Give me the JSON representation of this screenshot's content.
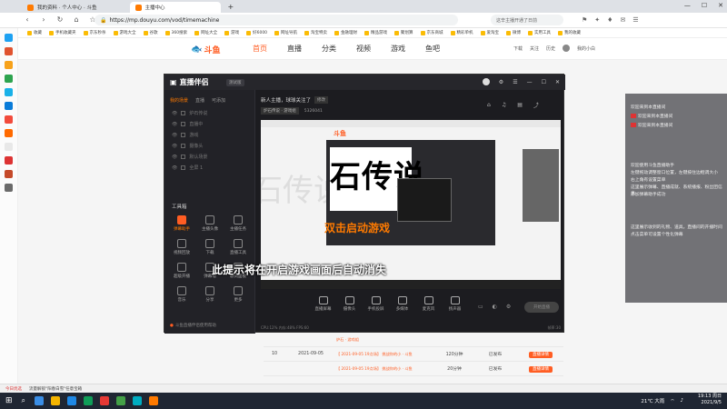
{
  "browser": {
    "tabs": [
      {
        "label": "我的资料 · 个人中心 · 斗鱼",
        "active": false
      },
      {
        "label": "主播中心",
        "active": true
      }
    ],
    "window_controls": [
      "—",
      "☐",
      "✕"
    ],
    "url": "https://mp.douyu.com/vod/timemachine",
    "search_placeholder": "这辛主播开通了日前",
    "bookmarks": [
      "收藏",
      "手机收藏夹",
      "京东秒杀",
      "游戏大全",
      "谷歌",
      "360搜索",
      "网址大全",
      "游戏",
      "好6000",
      "网址导航",
      "淘宝特卖",
      "金融理财",
      "精品游戏",
      "聚划算",
      "京东商城",
      "精彩单机",
      "爱淘宝",
      "微博",
      "实用工具",
      "我的收藏"
    ]
  },
  "douyu": {
    "logo": "斗鱼",
    "nav": [
      "首页",
      "直播",
      "分类",
      "视频",
      "游戏",
      "鱼吧"
    ],
    "active_nav": "首页",
    "right": [
      "下载",
      "关注",
      "历史",
      "我的小白"
    ]
  },
  "dialog": {
    "app_title": "直播伴侣",
    "version": "测试版",
    "window_controls": [
      "—",
      "☐",
      "✕"
    ],
    "left_tabs": [
      "我的场景",
      "直播",
      "可添加"
    ],
    "active_left_tab": "我的场景",
    "scenes": [
      "炉石传说",
      "直播中",
      "游戏",
      "摄像头",
      "默认场景",
      "全屏 1"
    ],
    "tools_heading": "工具箱",
    "tools": [
      {
        "label": "弹幕助手",
        "hot": true
      },
      {
        "label": "主播头像",
        "hot": false
      },
      {
        "label": "主播任务",
        "hot": false
      },
      {
        "label": "视频回放",
        "hot": false
      },
      {
        "label": "下载",
        "hot": false
      },
      {
        "label": "直播工具",
        "hot": false
      },
      {
        "label": "超级开播",
        "hot": false
      },
      {
        "label": "弹幕墙",
        "hot": false
      },
      {
        "label": "歌词面板",
        "hot": false
      },
      {
        "label": "音乐",
        "hot": false
      },
      {
        "label": "分享",
        "hot": false
      },
      {
        "label": "更多",
        "hot": false
      }
    ],
    "left_hint": "斗鱼直播伴侣使用帮助",
    "room_title": "新人主播，球球关注了",
    "room_tag": "修改",
    "category": "炉石传说 · 游戏组",
    "room_id": "5326041",
    "top_icons": [
      "⌂",
      "♫",
      "▤",
      "⤴"
    ],
    "preview_big_text": "石传说",
    "preview_overlay_orange": "双击启动游戏",
    "preview_overlay_white": "此提示将在开启游戏画面后自动消失",
    "preview_logo": "斗鱼",
    "bottom_tools": [
      "直播屏幕",
      "摄像头",
      "手机投屏",
      "多媒体",
      "麦克风",
      "扬声器"
    ],
    "go_live": "开始直播",
    "status_left": "CPU:12%  内存:48%  FPS:60",
    "status_right": "帧率:30"
  },
  "table": {
    "rows": [
      {
        "num": "",
        "date": "",
        "title": "炉石 · 游戏组",
        "duration": "",
        "status": "",
        "action": ""
      },
      {
        "num": "10",
        "date": "2021-09-05",
        "title": "【 2021-09-05 19点场】 挑战你的小 · 斗鱼",
        "duration": "120分钟",
        "status": "已发布",
        "action": "直播详情"
      },
      {
        "num": "",
        "date": "",
        "title": "【 2021-09-05 19点场】 挑战你的小 · 斗鱼",
        "duration": "20分钟",
        "status": "已发布",
        "action": "直播详情"
      }
    ]
  },
  "chat": {
    "messages": [
      {
        "text": "欢迎来到本直播间",
        "icon": false
      },
      {
        "text": "欢迎来到本直播间",
        "icon": true
      },
      {
        "text": "欢迎来到本直播间",
        "icon": true
      },
      {
        "text": "欢迎使用斗鱼直播助手",
        "icon": false
      },
      {
        "text": "左键拖动调整窗口位置，左键按住边框调大小",
        "icon": false
      },
      {
        "text": "右上角有设置菜单",
        "icon": false
      },
      {
        "text": "这里展示弹幕、直播成就、系统播报、粉丝团信息",
        "icon": false
      },
      {
        "text": "添加弹幕助手成功",
        "icon": false
      },
      {
        "text": "这里展示收到的礼物、道具，直播间的开播时间",
        "icon": false
      },
      {
        "text": "点击菜单可设置个性化弹幕",
        "icon": false
      }
    ]
  },
  "statusbar": {
    "left": "今日优选",
    "text": "流量解锁\"阳春白雪\"任意宝箱"
  },
  "taskbar": {
    "weather": "21℃ 大雨",
    "time": "19:13 周日",
    "date": "2021/9/5"
  },
  "colors": {
    "brand": "#ff5d23",
    "dialog_bg": "#1c1c20"
  }
}
